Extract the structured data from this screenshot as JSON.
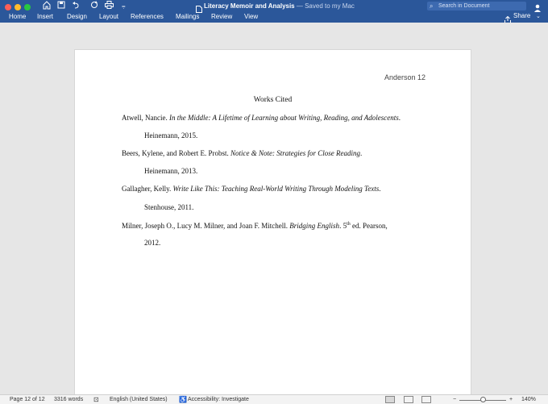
{
  "window": {
    "doc_name": "Literacy Memoir and Analysis",
    "save_status": "— Saved to my Mac",
    "search_placeholder": "Search in Document",
    "share_label": "Share"
  },
  "ribbon_tabs": [
    "Home",
    "Insert",
    "Design",
    "Layout",
    "References",
    "Mailings",
    "Review",
    "View"
  ],
  "document": {
    "header_text": "Anderson  12",
    "heading": "Works Cited",
    "entries": [
      {
        "prefix": "Atwell, Nancie. ",
        "title": "In the Middle: A Lifetime of Learning about Writing, Reading, and Adolescents",
        "suffix": ".",
        "continuation": "Heinemann, 2015."
      },
      {
        "prefix": "Beers, Kylene, and Robert E. Probst. ",
        "title": "Notice & Note: Strategies for Close Reading",
        "suffix": ".",
        "continuation": "Heinemann, 2013."
      },
      {
        "prefix": "Gallagher, Kelly. ",
        "title": "Write Like This: Teaching Real-World Writing Through Modeling Texts",
        "suffix": ".",
        "continuation": "Stenhouse, 2011."
      },
      {
        "prefix": "Milner, Joseph O., Lucy M. Milner, and Joan F. Mitchell. ",
        "title": "Bridging English",
        "suffix": ". 5",
        "sup": "th",
        "suffix2": " ed. Pearson,",
        "continuation": "2012."
      }
    ]
  },
  "status_bar": {
    "page": "Page 12 of 12",
    "words": "3316 words",
    "language": "English (United States)",
    "accessibility": "Accessibility: Investigate",
    "zoom_minus": "−",
    "zoom_plus": "+",
    "zoom": "140%"
  },
  "colors": {
    "ribbon": "#2b579a",
    "page": "#ffffff",
    "canvas": "#e6e6e6"
  },
  "icons": [
    "home-icon",
    "save-icon",
    "undo-icon",
    "redo-icon",
    "print-icon",
    "customize-icon",
    "word-doc-icon",
    "search-icon",
    "user-icon",
    "share-icon",
    "proofing-icon",
    "accessibility-icon",
    "print-layout-icon",
    "web-layout-icon",
    "focus-icon"
  ]
}
